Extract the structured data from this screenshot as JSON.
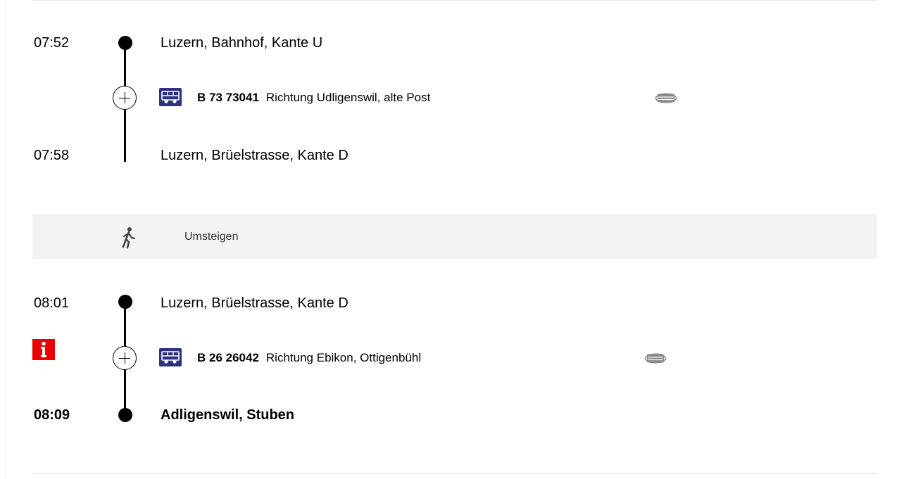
{
  "leg1": {
    "dep_time": "07:52",
    "dep_stop": "Luzern, Bahnhof, Kante U",
    "line": "B 73 73041",
    "direction": "Richtung Udligenswil, alte Post",
    "arr_time": "07:58",
    "arr_stop": "Luzern, Brüelstrasse, Kante D",
    "transport_icon": "bus-icon",
    "extra_icon": "face-mask-icon"
  },
  "transfer": {
    "label": "Umsteigen",
    "icon": "walking-person-icon"
  },
  "leg2": {
    "dep_time": "08:01",
    "dep_stop": "Luzern, Brüelstrasse, Kante D",
    "line": "B 26 26042",
    "direction": "Richtung Ebikon, Ottigenbühl",
    "arr_time": "08:09",
    "arr_stop": "Adligenswil, Stuben",
    "transport_icon": "bus-icon",
    "extra_icon": "face-mask-icon",
    "alert_icon": "info-icon"
  },
  "colors": {
    "bus_badge": "#2d327d",
    "info_red": "#eb0000",
    "transfer_bg": "#f3f3f3",
    "divider": "#e5e5e5"
  }
}
